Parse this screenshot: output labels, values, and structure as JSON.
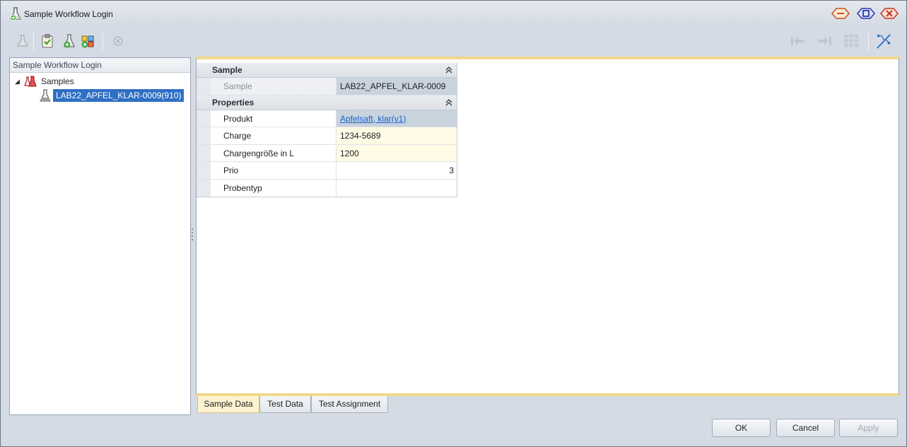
{
  "window": {
    "title": "Sample Workflow Login"
  },
  "toolbar": {
    "left_icons": [
      "flask-disabled-icon",
      "clipboard-check-icon",
      "flask-add-icon",
      "batch-add-icon",
      "cancel-icon"
    ],
    "right_icons": [
      "previous-icon",
      "next-icon",
      "grid-icon",
      "workflow-icon"
    ]
  },
  "tree": {
    "header": "Sample Workflow Login",
    "root_label": "Samples",
    "child_label": "LAB22_APFEL_KLAR-0009(910)"
  },
  "grid": {
    "sample_category": "Sample",
    "sample_name_label": "Sample",
    "sample_name_value": "LAB22_APFEL_KLAR-0009",
    "properties_category": "Properties",
    "rows": [
      {
        "label": "Produkt",
        "value": "Apfelsaft, klar(v1)"
      },
      {
        "label": "Charge",
        "value": "1234-5689"
      },
      {
        "label": "Chargengröße in L",
        "value": "1200"
      },
      {
        "label": "Prio",
        "value": "3"
      },
      {
        "label": "Probentyp",
        "value": ""
      }
    ]
  },
  "tabs": [
    "Sample Data",
    "Test Data",
    "Test Assignment"
  ],
  "buttons": {
    "ok": "OK",
    "cancel": "Cancel",
    "apply": "Apply"
  },
  "colors": {
    "selection": "#2f6fc4",
    "editable_cell": "#fffbe6",
    "accent_border": "#f0d98c",
    "link": "#1b63c9"
  }
}
